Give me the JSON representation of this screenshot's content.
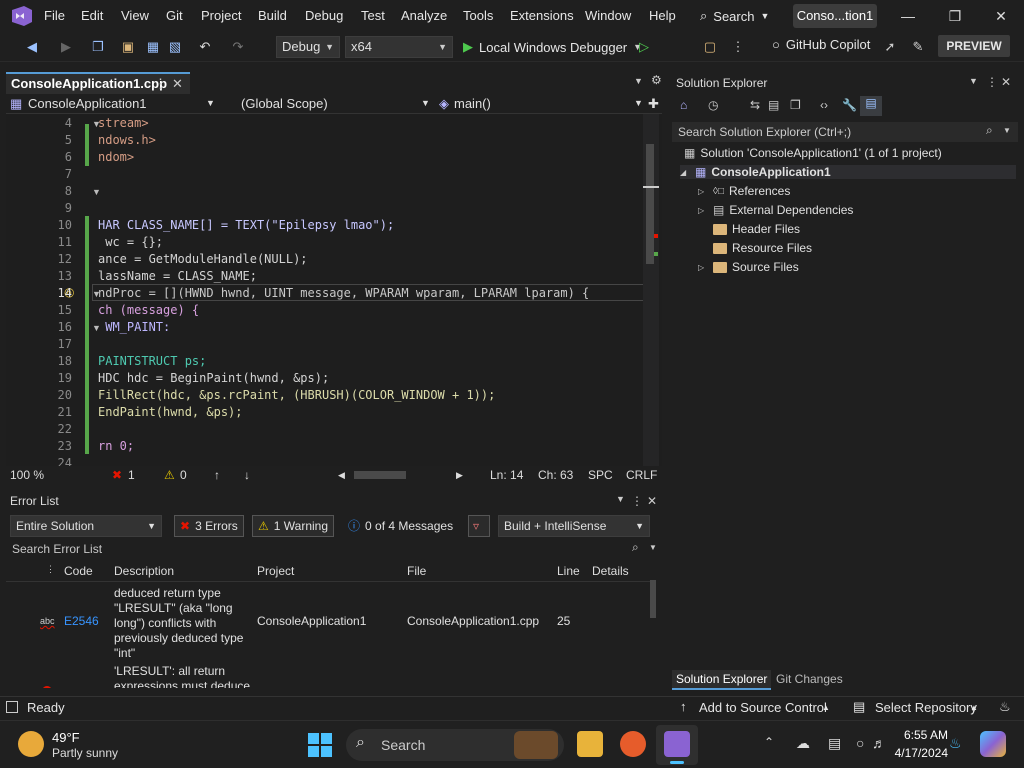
{
  "menubar": {
    "items": [
      "File",
      "Edit",
      "View",
      "Git",
      "Project",
      "Build",
      "Debug",
      "Test",
      "Analyze",
      "Tools",
      "Extensions",
      "Window",
      "Help"
    ],
    "search_label": "Search",
    "window_title": "Conso...tion1"
  },
  "toolbar": {
    "config": "Debug",
    "platform": "x64",
    "run_label": "Local Windows Debugger",
    "copilot_label": "GitHub Copilot",
    "preview_label": "PREVIEW"
  },
  "editor": {
    "tab_label": "ConsoleApplication1.cpp",
    "nav_project": "ConsoleApplication1",
    "nav_scope": "(Global Scope)",
    "nav_function": "main()",
    "line_numbers": [
      "4",
      "5",
      "6",
      "7",
      "8",
      "9",
      "10",
      "11",
      "12",
      "13",
      "14",
      "15",
      "16",
      "17",
      "18",
      "19",
      "20",
      "21",
      "22",
      "23",
      "24"
    ],
    "lines": [
      "stream>",
      "ndows.h>",
      "ndom>",
      "",
      "",
      "",
      "HAR CLASS_NAME[] = TEXT(\"Epilepsy lmao\");",
      " wc = {};",
      "ance = GetModuleHandle(NULL);",
      "lassName = CLASS_NAME;",
      "ndProc = [](HWND hwnd, UINT message, WPARAM wparam, LPARAM lparam) {",
      "ch (message) {",
      " WM_PAINT:",
      "",
      "PAINTSTRUCT ps;",
      "HDC hdc = BeginPaint(hwnd, &ps);",
      "FillRect(hdc, &ps.rcPaint, (HBRUSH)(COLOR_WINDOW + 1));",
      "EndPaint(hwnd, &ps);",
      "",
      "rn 0;",
      ""
    ],
    "status": {
      "zoom": "100 %",
      "errors": "1",
      "warnings": "0",
      "line": "Ln: 14",
      "col": "Ch: 63",
      "spacing": "SPC",
      "eol": "CRLF"
    }
  },
  "error_list": {
    "title": "Error List",
    "scope": "Entire Solution",
    "errors_label": "3 Errors",
    "warnings_label": "1 Warning",
    "messages_label": "0 of 4 Messages",
    "build_filter": "Build + IntelliSense",
    "search_placeholder": "Search Error List",
    "columns": [
      "Code",
      "Description",
      "Project",
      "File",
      "Line",
      "Details"
    ],
    "rows": [
      {
        "code": "E2546",
        "description_lines": [
          "deduced return type",
          "\"LRESULT\" (aka \"long",
          "long\") conflicts with",
          "previously deduced type",
          "\"int\""
        ],
        "project": "ConsoleApplication1",
        "file": "ConsoleApplication1.cpp",
        "line": "25"
      },
      {
        "code": "",
        "description_lines": [
          "'LRESULT': all return",
          "expressions must deduce"
        ],
        "project": "",
        "file": "",
        "line": ""
      }
    ]
  },
  "solution_explorer": {
    "title": "Solution Explorer",
    "search_placeholder": "Search Solution Explorer (Ctrl+;)",
    "solution_label": "Solution 'ConsoleApplication1' (1 of 1 project)",
    "project_label": "ConsoleApplication1",
    "nodes": [
      "References",
      "External Dependencies",
      "Header Files",
      "Resource Files",
      "Source Files"
    ],
    "bottom_tabs": [
      "Solution Explorer",
      "Git Changes"
    ]
  },
  "statusbar": {
    "ready": "Ready",
    "source_control": "Add to Source Control",
    "repository": "Select Repository"
  },
  "taskbar": {
    "weather_temp": "49°F",
    "weather_desc": "Partly sunny",
    "search_label": "Search",
    "time": "6:55 AM",
    "date": "4/17/2024"
  }
}
